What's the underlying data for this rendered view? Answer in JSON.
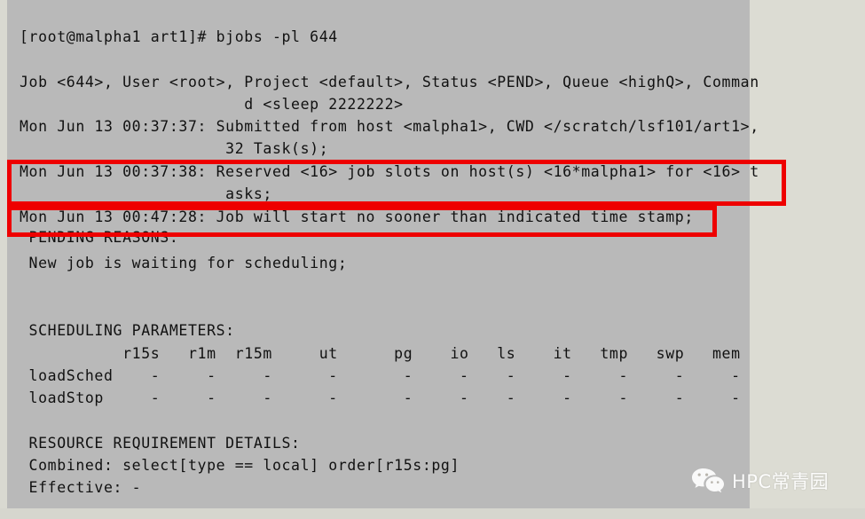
{
  "terminal": {
    "background_color": "#b9b9b9",
    "margin_color": "#dcdcd3",
    "text_color": "#111111",
    "lines": [
      {
        "id": "prompt",
        "text": "[root@malpha1 art1]# bjobs -pl 644"
      },
      {
        "id": "blank1",
        "text": ""
      },
      {
        "id": "job_header",
        "text": "Job <644>, User <root>, Project <default>, Status <PEND>, Queue <highQ>, Comman"
      },
      {
        "id": "job_command",
        "text": "                        d <sleep 2222222>"
      },
      {
        "id": "submitted",
        "text": "Mon Jun 13 00:37:37: Submitted from host <malpha1>, CWD </scratch/lsf101/art1>,"
      },
      {
        "id": "tasks",
        "text": "                      32 Task(s);"
      },
      {
        "id": "reserved",
        "text": "Mon Jun 13 00:37:38: Reserved <16> job slots on host(s) <16*malpha1> for <16> t"
      },
      {
        "id": "reserved_2",
        "text": "                      asks;"
      },
      {
        "id": "start_time",
        "text": "Mon Jun 13 00:47:28: Job will start no sooner than indicated time stamp;"
      },
      {
        "id": "pending_hdr",
        "text": " PENDING REASONS:"
      },
      {
        "id": "pending_rsn",
        "text": " New job is waiting for scheduling;"
      },
      {
        "id": "blank2",
        "text": ""
      },
      {
        "id": "blank3",
        "text": ""
      },
      {
        "id": "sched_hdr",
        "text": " SCHEDULING PARAMETERS:"
      }
    ],
    "table": {
      "columns": [
        "r15s",
        "r1m",
        "r15m",
        "ut",
        "pg",
        "io",
        "ls",
        "it",
        "tmp",
        "swp",
        "mem"
      ],
      "header_row": "           r15s   r1m  r15m     ut      pg    io   ls    it   tmp   swp   mem",
      "rows": [
        {
          "label": "loadSched",
          "values": [
            "-",
            "-",
            "-",
            "-",
            "-",
            "-",
            "-",
            "-",
            "-",
            "-",
            "-"
          ],
          "text": " loadSched    -     -     -      -       -     -    -     -     -     -     -"
        },
        {
          "label": "loadStop",
          "values": [
            "-",
            "-",
            "-",
            "-",
            "-",
            "-",
            "-",
            "-",
            "-",
            "-",
            "-"
          ],
          "text": " loadStop     -     -     -      -       -     -    -     -     -     -     -"
        }
      ]
    },
    "resource": {
      "header": " RESOURCE REQUIREMENT DETAILS:",
      "combined": " Combined: select[type == local] order[r15s:pg]",
      "effective": " Effective: -"
    }
  },
  "annotations": {
    "color": "#ee0000",
    "boxes": [
      {
        "id": "reserved-slots",
        "label": "Reserved job slots highlight"
      },
      {
        "id": "start-time",
        "label": "Job start time highlight"
      }
    ]
  },
  "watermark": {
    "icon": "wechat-icon",
    "text": "HPC常青园",
    "color": "#ffffff"
  }
}
